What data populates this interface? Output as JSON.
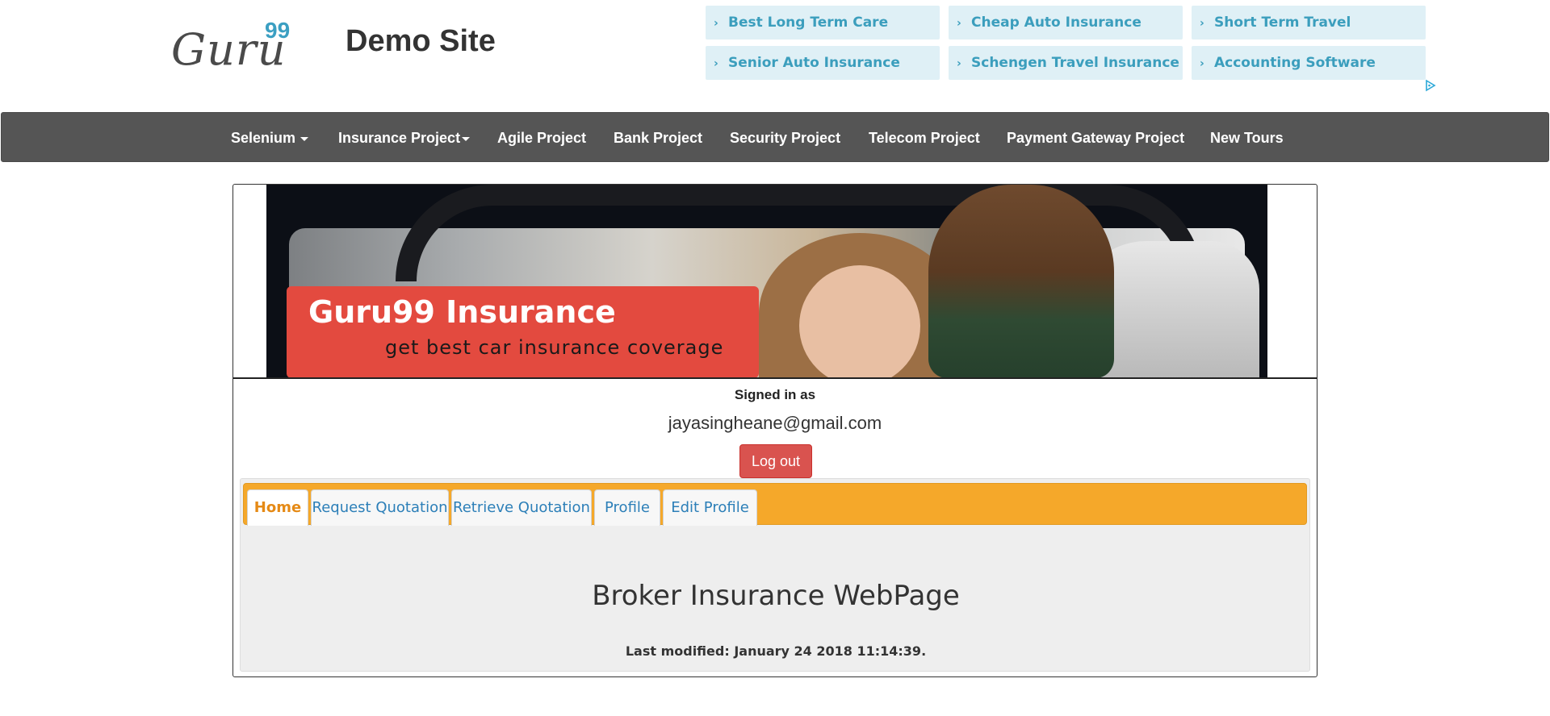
{
  "header": {
    "logo": {
      "text": "Guru",
      "superscript": "99"
    },
    "site_title": "Demo Site",
    "ads": [
      "Best Long Term Care",
      "Cheap Auto Insurance",
      "Short Term Travel",
      "Senior Auto Insurance",
      "Schengen Travel Insurance",
      "Accounting Software"
    ],
    "ad_chevron": "›",
    "adchoices_icon": "adchoices-icon"
  },
  "nav": {
    "items": [
      "Selenium",
      "Insurance Project",
      "Agile Project",
      "Bank Project",
      "Security Project",
      "Telecom Project",
      "Payment Gateway Project",
      "New Tours"
    ]
  },
  "banner": {
    "title": "Guru99 Insurance",
    "subtitle": "get best car insurance coverage"
  },
  "account": {
    "signed_in_label": "Signed in as",
    "email": "jayasingheane@gmail.com",
    "logout_label": "Log out"
  },
  "tabs": {
    "items": [
      "Home",
      "Request Quotation",
      "Retrieve Quotation",
      "Profile",
      "Edit Profile"
    ],
    "active": "Home"
  },
  "content": {
    "heading": "Broker Insurance WebPage",
    "last_modified": "Last modified: January 24 2018 11:14:39."
  },
  "colors": {
    "navbar": "#555555",
    "tabbar": "#f5a82a",
    "logout": "#d9534f",
    "ad_bg": "#dff0f6",
    "ad_text": "#3b9ebd",
    "tab_link": "#2c7fb8",
    "tab_active": "#e58a16"
  }
}
